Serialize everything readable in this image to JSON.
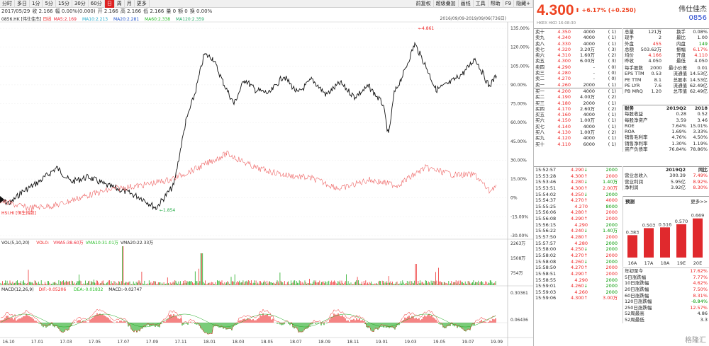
{
  "toolbar": {
    "left": [
      "分时",
      "多日",
      "1分",
      "5分",
      "15分",
      "30分",
      "60分",
      "日",
      "周",
      "月",
      "更多"
    ],
    "active_index": 7,
    "right": [
      "前复权",
      "超级叠加",
      "画线",
      "工具",
      "帮助",
      "F9",
      "隐藏+"
    ]
  },
  "infobar": {
    "items": [
      "2017/05/29",
      "收 2.166",
      "幅 0.00%(0.000)",
      "开 2.166",
      "高 2.166",
      "低 2.166",
      "量 0",
      "额 0",
      "换 0.00%"
    ]
  },
  "legend": {
    "stock": "0856.HK [伟仕佳杰]",
    "period": "日线",
    "ma5": "MA5:2.169",
    "ma10": "MA10:2.213",
    "ma20": "MA20:2.281",
    "ma60": "MA60:2.338",
    "ma120": "MA120:2.359",
    "range": "2016/09/09-2019/09/06(736日)",
    "benchmark": "HSI.HI [恒生指数]",
    "low_label": "1.854",
    "high_label": "4.861"
  },
  "colors": {
    "ma5": "#e23",
    "ma10": "#2ac",
    "ma20": "#25c",
    "ma60": "#2b2",
    "ma120": "#2a6",
    "up": "#e22",
    "down": "#090",
    "accent": "#e42"
  },
  "price_axis": [
    "135.00%",
    "120.00%",
    "105.00%",
    "90.00%",
    "75.00%",
    "60.00%",
    "45.00%",
    "30.00%",
    "15.00%",
    "0%",
    "-15.00%",
    "-30.00%"
  ],
  "vol": {
    "label": "VOL(5,10,20)",
    "vol0": "VOL0:",
    "vma5": "VMA5:38.60万",
    "vma10": "VMA10:31.01万",
    "vma20": "VMA20:22.33万",
    "axis": [
      "2263万",
      "1508万",
      "754万"
    ]
  },
  "macd": {
    "label": "MACD(12,26,9)",
    "dif": "DIF:-0.05206",
    "dea": "DEA:-0.01832",
    "macd": "MACD:-0.02747",
    "axis": [
      "0.30361",
      "0.06436"
    ]
  },
  "x_axis": [
    "16.10",
    "17.01",
    "17.03",
    "17.05",
    "17.07",
    "17.09",
    "17.11",
    "18.01",
    "18.03",
    "18.05",
    "18.07",
    "18.09",
    "18.11",
    "19.01",
    "19.03",
    "19.05",
    "19.07",
    "19.09"
  ],
  "quote": {
    "price": "4.300",
    "change": "+6.17% (+0.250)",
    "market": "HKEX  HKD  16:08:30",
    "name": "伟仕佳杰",
    "code": "0856"
  },
  "asks": [
    [
      "卖十",
      "4.350",
      "4000",
      "( 1)"
    ],
    [
      "卖九",
      "4.340",
      "4000",
      "( 1)"
    ],
    [
      "卖八",
      "4.330",
      "4000",
      "( 1)"
    ],
    [
      "卖七",
      "4.320",
      "3.20万",
      "( 3)"
    ],
    [
      "卖六",
      "4.310",
      "1.60万",
      "( 2)"
    ],
    [
      "卖五",
      "4.300",
      "6.00万",
      "( 3)"
    ],
    [
      "卖四",
      "4.290",
      "-",
      "( 0)"
    ],
    [
      "卖三",
      "4.280",
      "-",
      "( 0)"
    ],
    [
      "卖二",
      "4.270",
      "-",
      "( 0)"
    ],
    [
      "卖一",
      "4.260",
      "2000",
      "( 1)"
    ]
  ],
  "bids": [
    [
      "买一",
      "4.200",
      "4000",
      "( 1)"
    ],
    [
      "买二",
      "4.190",
      "4.00万",
      "( 2)"
    ],
    [
      "买三",
      "4.180",
      "2000",
      "( 1)"
    ],
    [
      "买四",
      "4.170",
      "2.60万",
      "( 2)"
    ],
    [
      "买五",
      "4.160",
      "4000",
      "( 1)"
    ],
    [
      "买六",
      "4.150",
      "1.00万",
      "( 1)"
    ],
    [
      "买七",
      "4.140",
      "4000",
      "( 1)"
    ],
    [
      "买八",
      "4.130",
      "1.00万",
      "( 2)"
    ],
    [
      "买九",
      "4.120",
      "4000",
      "( 1)"
    ],
    [
      "买十",
      "4.110",
      "6000",
      "( 1)"
    ]
  ],
  "stats": [
    [
      "总量",
      "121万",
      "换手",
      "0.08%"
    ],
    [
      "现手",
      "2",
      "最比",
      "1.00"
    ],
    [
      "外盘",
      "455",
      "内盘",
      "149"
    ],
    [
      "总额",
      "503.62万",
      "振幅",
      "6.17%"
    ],
    [
      "均价",
      "4.166",
      "开盘",
      "4.110"
    ],
    [
      "昨收",
      "4.050",
      "最低",
      "4.050"
    ]
  ],
  "indicators": [
    [
      "每手股数",
      "2000",
      "最小价差",
      "0.01"
    ],
    [
      "EPS TTM",
      "0.53",
      "流通值",
      "14.53亿"
    ],
    [
      "PE TTM",
      "8.1",
      "总股本",
      "14.53亿"
    ],
    [
      "PE LYR",
      "7.6",
      "流通值",
      "62.49亿"
    ],
    [
      "PB MRQ",
      "1.20",
      "总市值",
      "62.49亿"
    ]
  ],
  "finance": {
    "header": [
      "财务",
      "2019Q2",
      "2018"
    ],
    "rows": [
      [
        "每股收益",
        "0.28",
        "0.52"
      ],
      [
        "每股净资产",
        "3.59",
        "3.46"
      ],
      [
        "ROE",
        "7.64%",
        "15.01%"
      ],
      [
        "ROA",
        "1.69%",
        "3.33%"
      ],
      [
        "销售毛利率",
        "4.76%",
        "4.50%"
      ],
      [
        "销售净利率",
        "1.30%",
        "1.19%"
      ],
      [
        "资产负债率",
        "76.84%",
        "78.86%"
      ]
    ]
  },
  "finance2": {
    "header": [
      "",
      "2019Q2",
      "同比"
    ],
    "rows": [
      [
        "营业总收入",
        "300.39",
        "7.49%"
      ],
      [
        "营业利润",
        "5.95亿",
        "8.92%"
      ],
      [
        "净利润",
        "3.92亿",
        "8.30%"
      ]
    ]
  },
  "forecast": {
    "title": "预测",
    "more": "更多>>",
    "categories": [
      "16A",
      "17A",
      "18A",
      "19E",
      "20E"
    ],
    "values": [
      0.383,
      0.503,
      0.516,
      0.57,
      0.669
    ]
  },
  "ticks": [
    [
      "15:52:57",
      "4.290",
      "2000",
      "g"
    ],
    [
      "15:53:28",
      "4.300",
      "2000",
      "r"
    ],
    [
      "15:53:46",
      "4.280",
      "1.40万",
      "g"
    ],
    [
      "15:53:51",
      "4.300",
      "2.00万",
      "r"
    ],
    [
      "15:54:02",
      "4.250",
      "2000",
      "g"
    ],
    [
      "15:54:37",
      "4.270",
      "4000",
      "r"
    ],
    [
      "15:55:25",
      "4.270",
      "8000",
      "g"
    ],
    [
      "15:56:06",
      "4.280",
      "2000",
      "r"
    ],
    [
      "15:56:08",
      "4.290",
      "2000",
      "r"
    ],
    [
      "15:56:15",
      "4.290",
      "2000",
      "g"
    ],
    [
      "15:56:22",
      "4.240",
      "1.40万",
      "g"
    ],
    [
      "15:57:50",
      "4.280",
      "2000",
      "r"
    ],
    [
      "15:57:57",
      "4.280",
      "2000",
      "g"
    ],
    [
      "15:58:00",
      "4.250",
      "2000",
      "g"
    ],
    [
      "15:58:02",
      "4.270",
      "2000",
      "r"
    ],
    [
      "15:58:08",
      "4.260",
      "2000",
      "g"
    ],
    [
      "15:58:50",
      "4.270",
      "2000",
      "r"
    ],
    [
      "15:58:51",
      "4.290",
      "2000",
      "r"
    ],
    [
      "15:58:55",
      "4.290",
      "2000",
      "g"
    ],
    [
      "15:59:01",
      "4.260",
      "2000",
      "g"
    ],
    [
      "15:59:03",
      "4.260",
      "2000",
      "g"
    ],
    [
      "15:59:06",
      "4.300",
      "3.00万",
      "r"
    ]
  ],
  "ticks_dirs": [
    "↓",
    "↑",
    "↓",
    "↑",
    "↓",
    "↑",
    "",
    "↑",
    "↑",
    "",
    "↓",
    "↑",
    "",
    "↓",
    "↑",
    "↓",
    "↑",
    "↑",
    "",
    "↓",
    "",
    "↑"
  ],
  "performance": [
    [
      "年初至今",
      "17.62%",
      "r"
    ],
    [
      "5日涨跌幅",
      "7.77%",
      "r"
    ],
    [
      "10日涨跌幅",
      "4.62%",
      "r"
    ],
    [
      "20日涨跌幅",
      "7.50%",
      "r"
    ],
    [
      "60日涨跌幅",
      "8.31%",
      "r"
    ],
    [
      "120日涨跌幅",
      "-8.84%",
      "g"
    ],
    [
      "250日涨跌幅",
      "12.57%",
      "r"
    ],
    [
      "52周最高",
      "4.86",
      ""
    ],
    [
      "52周最低",
      "3.3",
      ""
    ]
  ],
  "watermark": "格隆汇"
}
